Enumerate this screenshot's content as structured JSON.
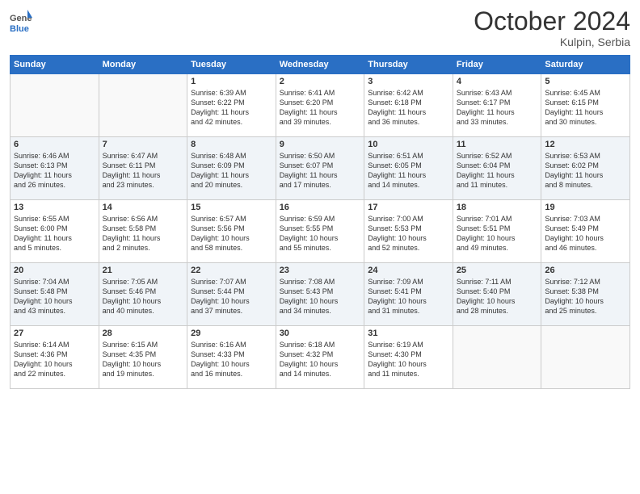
{
  "header": {
    "logo_general": "General",
    "logo_blue": "Blue",
    "month_title": "October 2024",
    "location": "Kulpin, Serbia"
  },
  "days_of_week": [
    "Sunday",
    "Monday",
    "Tuesday",
    "Wednesday",
    "Thursday",
    "Friday",
    "Saturday"
  ],
  "weeks": [
    {
      "shaded": false,
      "days": [
        {
          "num": "",
          "info": ""
        },
        {
          "num": "",
          "info": ""
        },
        {
          "num": "1",
          "info": "Sunrise: 6:39 AM\nSunset: 6:22 PM\nDaylight: 11 hours\nand 42 minutes."
        },
        {
          "num": "2",
          "info": "Sunrise: 6:41 AM\nSunset: 6:20 PM\nDaylight: 11 hours\nand 39 minutes."
        },
        {
          "num": "3",
          "info": "Sunrise: 6:42 AM\nSunset: 6:18 PM\nDaylight: 11 hours\nand 36 minutes."
        },
        {
          "num": "4",
          "info": "Sunrise: 6:43 AM\nSunset: 6:17 PM\nDaylight: 11 hours\nand 33 minutes."
        },
        {
          "num": "5",
          "info": "Sunrise: 6:45 AM\nSunset: 6:15 PM\nDaylight: 11 hours\nand 30 minutes."
        }
      ]
    },
    {
      "shaded": true,
      "days": [
        {
          "num": "6",
          "info": "Sunrise: 6:46 AM\nSunset: 6:13 PM\nDaylight: 11 hours\nand 26 minutes."
        },
        {
          "num": "7",
          "info": "Sunrise: 6:47 AM\nSunset: 6:11 PM\nDaylight: 11 hours\nand 23 minutes."
        },
        {
          "num": "8",
          "info": "Sunrise: 6:48 AM\nSunset: 6:09 PM\nDaylight: 11 hours\nand 20 minutes."
        },
        {
          "num": "9",
          "info": "Sunrise: 6:50 AM\nSunset: 6:07 PM\nDaylight: 11 hours\nand 17 minutes."
        },
        {
          "num": "10",
          "info": "Sunrise: 6:51 AM\nSunset: 6:05 PM\nDaylight: 11 hours\nand 14 minutes."
        },
        {
          "num": "11",
          "info": "Sunrise: 6:52 AM\nSunset: 6:04 PM\nDaylight: 11 hours\nand 11 minutes."
        },
        {
          "num": "12",
          "info": "Sunrise: 6:53 AM\nSunset: 6:02 PM\nDaylight: 11 hours\nand 8 minutes."
        }
      ]
    },
    {
      "shaded": false,
      "days": [
        {
          "num": "13",
          "info": "Sunrise: 6:55 AM\nSunset: 6:00 PM\nDaylight: 11 hours\nand 5 minutes."
        },
        {
          "num": "14",
          "info": "Sunrise: 6:56 AM\nSunset: 5:58 PM\nDaylight: 11 hours\nand 2 minutes."
        },
        {
          "num": "15",
          "info": "Sunrise: 6:57 AM\nSunset: 5:56 PM\nDaylight: 10 hours\nand 58 minutes."
        },
        {
          "num": "16",
          "info": "Sunrise: 6:59 AM\nSunset: 5:55 PM\nDaylight: 10 hours\nand 55 minutes."
        },
        {
          "num": "17",
          "info": "Sunrise: 7:00 AM\nSunset: 5:53 PM\nDaylight: 10 hours\nand 52 minutes."
        },
        {
          "num": "18",
          "info": "Sunrise: 7:01 AM\nSunset: 5:51 PM\nDaylight: 10 hours\nand 49 minutes."
        },
        {
          "num": "19",
          "info": "Sunrise: 7:03 AM\nSunset: 5:49 PM\nDaylight: 10 hours\nand 46 minutes."
        }
      ]
    },
    {
      "shaded": true,
      "days": [
        {
          "num": "20",
          "info": "Sunrise: 7:04 AM\nSunset: 5:48 PM\nDaylight: 10 hours\nand 43 minutes."
        },
        {
          "num": "21",
          "info": "Sunrise: 7:05 AM\nSunset: 5:46 PM\nDaylight: 10 hours\nand 40 minutes."
        },
        {
          "num": "22",
          "info": "Sunrise: 7:07 AM\nSunset: 5:44 PM\nDaylight: 10 hours\nand 37 minutes."
        },
        {
          "num": "23",
          "info": "Sunrise: 7:08 AM\nSunset: 5:43 PM\nDaylight: 10 hours\nand 34 minutes."
        },
        {
          "num": "24",
          "info": "Sunrise: 7:09 AM\nSunset: 5:41 PM\nDaylight: 10 hours\nand 31 minutes."
        },
        {
          "num": "25",
          "info": "Sunrise: 7:11 AM\nSunset: 5:40 PM\nDaylight: 10 hours\nand 28 minutes."
        },
        {
          "num": "26",
          "info": "Sunrise: 7:12 AM\nSunset: 5:38 PM\nDaylight: 10 hours\nand 25 minutes."
        }
      ]
    },
    {
      "shaded": false,
      "days": [
        {
          "num": "27",
          "info": "Sunrise: 6:14 AM\nSunset: 4:36 PM\nDaylight: 10 hours\nand 22 minutes."
        },
        {
          "num": "28",
          "info": "Sunrise: 6:15 AM\nSunset: 4:35 PM\nDaylight: 10 hours\nand 19 minutes."
        },
        {
          "num": "29",
          "info": "Sunrise: 6:16 AM\nSunset: 4:33 PM\nDaylight: 10 hours\nand 16 minutes."
        },
        {
          "num": "30",
          "info": "Sunrise: 6:18 AM\nSunset: 4:32 PM\nDaylight: 10 hours\nand 14 minutes."
        },
        {
          "num": "31",
          "info": "Sunrise: 6:19 AM\nSunset: 4:30 PM\nDaylight: 10 hours\nand 11 minutes."
        },
        {
          "num": "",
          "info": ""
        },
        {
          "num": "",
          "info": ""
        }
      ]
    }
  ]
}
